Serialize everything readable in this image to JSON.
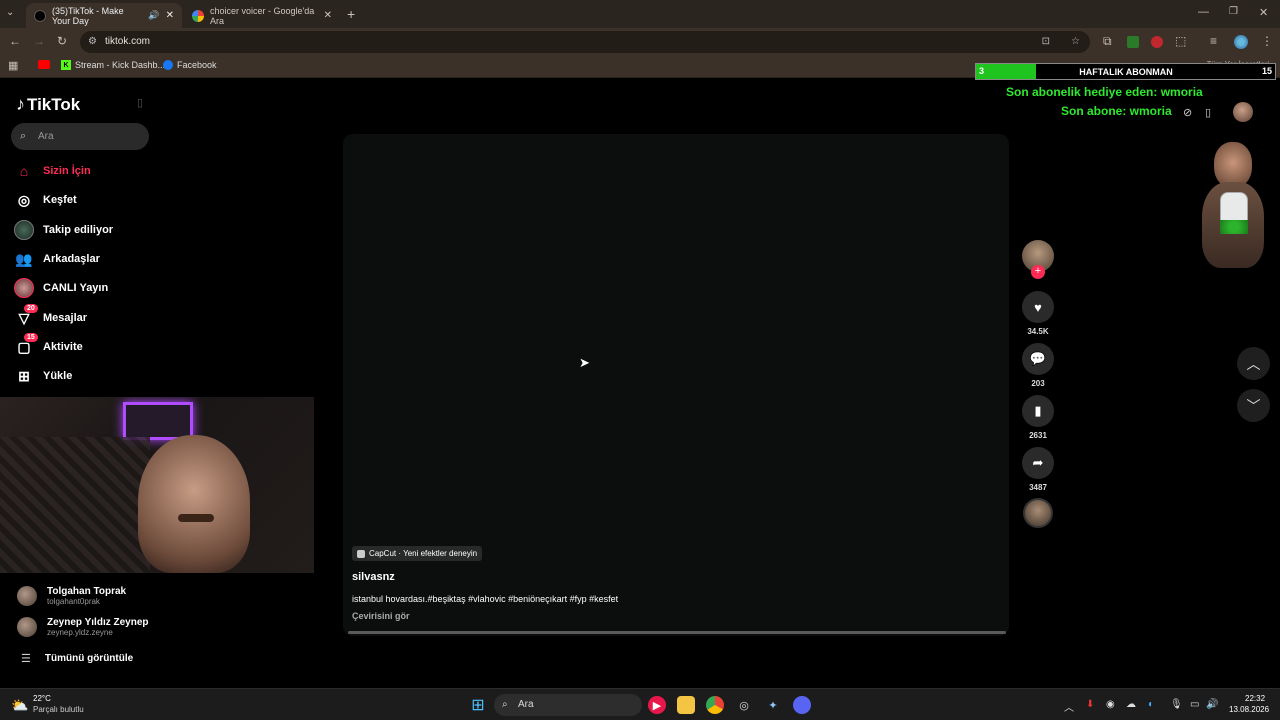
{
  "browser": {
    "tabs": [
      {
        "title": "(35)TikTok - Make Your Day",
        "active": true
      },
      {
        "title": "choicer voicer - Google'da Ara",
        "active": false
      }
    ],
    "url": "tiktok.com",
    "bookmarks": [
      {
        "label": ""
      },
      {
        "label": "Stream - Kick Dashb..."
      },
      {
        "label": "Facebook"
      }
    ],
    "all_bookmarks": "Tüm Yer İşaretleri"
  },
  "sidebar": {
    "brand": "TikTok",
    "search_placeholder": "Ara",
    "items": [
      {
        "label": "Sizin İçin",
        "icon": "home-icon",
        "active": true
      },
      {
        "label": "Keşfet",
        "icon": "compass-icon"
      },
      {
        "label": "Takip ediliyor",
        "icon": "following-avatar-icon"
      },
      {
        "label": "Arkadaşlar",
        "icon": "friends-icon"
      },
      {
        "label": "CANLI Yayın",
        "icon": "live-avatar-icon"
      },
      {
        "label": "Mesajlar",
        "icon": "send-icon",
        "badge": "20"
      },
      {
        "label": "Aktivite",
        "icon": "activity-icon",
        "badge": "15"
      },
      {
        "label": "Yükle",
        "icon": "upload-icon"
      }
    ],
    "following_accounts": [
      {
        "name": "Tolgahan Toprak",
        "handle": "tolgahant0prak"
      },
      {
        "name": "Zeynep Yıldız Zeynep",
        "handle": "zeynep.yldz.zeyne"
      }
    ],
    "see_all": "Tümünü görüntüle"
  },
  "video": {
    "effect": "CapCut · Yeni efektler deneyin",
    "author": "silvasnz",
    "caption": "istanbul hovardası.#beşiktaş #vlahovic #beniöneçıkart #fyp #kesfet",
    "translate": "Çevirisini gör",
    "likes": "34.5K",
    "comments": "203",
    "saves": "2631",
    "shares": "3487"
  },
  "overlay": {
    "sub_count": "3",
    "sub_goal": "15",
    "sub_label": "HAFTALIK ABONMAN",
    "sub_progress": 0.2,
    "gift_line": "Son abonelik hediye eden: wmoria",
    "sub_line": "Son abone: wmoria"
  },
  "taskbar": {
    "weather_temp": "22°C",
    "weather_desc": "Parçalı bulutlu",
    "search": "Ara",
    "time": "22:32",
    "date": "13.08.2026"
  },
  "colors": {
    "accent": "#fe2c55",
    "overlay_green": "#2ee82e"
  }
}
